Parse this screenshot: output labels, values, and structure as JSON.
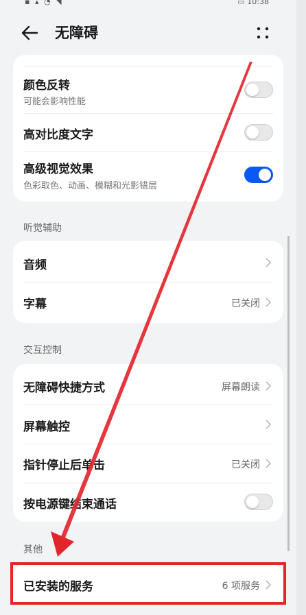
{
  "status_bar": {
    "left": "▪ ▴ ◔ ◥",
    "right": "▭ 10:38"
  },
  "header": {
    "title": "无障碍",
    "back_icon": "back-arrow-icon",
    "more_icon": "more-dots-icon"
  },
  "vision_card": {
    "rows": [
      {
        "title": "颜色反转",
        "subtitle": "可能会影响性能",
        "toggle": false
      },
      {
        "title": "高对比度文字",
        "toggle": false
      },
      {
        "title": "高级视觉效果",
        "subtitle": "色彩取色、动画、模糊和光影错层",
        "toggle": true
      }
    ]
  },
  "hearing_section": {
    "header": "听觉辅助",
    "rows": [
      {
        "title": "音频",
        "value": ""
      },
      {
        "title": "字幕",
        "value": "已关闭"
      }
    ]
  },
  "interaction_section": {
    "header": "交互控制",
    "rows": [
      {
        "title": "无障碍快捷方式",
        "value": "屏幕朗读"
      },
      {
        "title": "屏幕触控",
        "value": ""
      },
      {
        "title": "指针停止后单击",
        "value": "已关闭"
      },
      {
        "title": "按电源键结束通话",
        "toggle": false
      }
    ]
  },
  "other_section": {
    "header": "其他",
    "rows": [
      {
        "title": "已安装的服务",
        "value": "6 项服务"
      }
    ]
  },
  "colors": {
    "accent": "#0a59f7",
    "annotation": "#e3262c",
    "background": "#f1f3f5",
    "card": "#ffffff"
  }
}
